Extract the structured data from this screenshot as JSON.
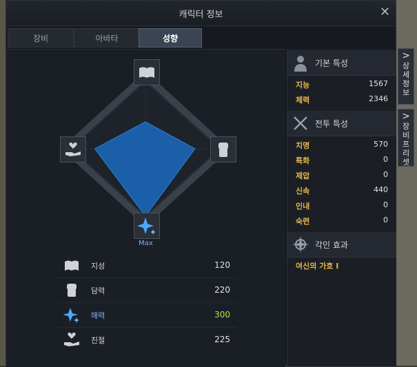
{
  "window": {
    "title": "캐릭터 정보",
    "close": "✕"
  },
  "tabs": [
    {
      "label": "장비",
      "active": false
    },
    {
      "label": "아바타",
      "active": false
    },
    {
      "label": "성향",
      "active": true
    }
  ],
  "trait_chart": {
    "max_label": "Max",
    "axes": [
      "지성",
      "담력",
      "매력",
      "친절"
    ]
  },
  "traits": [
    {
      "name": "지성",
      "value": "120",
      "icon": "book-icon"
    },
    {
      "name": "담력",
      "value": "220",
      "icon": "fist-icon"
    },
    {
      "name": "매력",
      "value": "300",
      "icon": "sparkle-icon",
      "highlight": true
    },
    {
      "name": "친절",
      "value": "225",
      "icon": "heart-hand-icon"
    }
  ],
  "basic_stats": {
    "title": "기본 특성",
    "rows": [
      {
        "label": "지능",
        "value": "1567"
      },
      {
        "label": "체력",
        "value": "2346"
      }
    ]
  },
  "combat_stats": {
    "title": "전투 특성",
    "rows": [
      {
        "label": "치명",
        "value": "570"
      },
      {
        "label": "특화",
        "value": "0"
      },
      {
        "label": "제압",
        "value": "0"
      },
      {
        "label": "신속",
        "value": "440"
      },
      {
        "label": "인내",
        "value": "0"
      },
      {
        "label": "숙련",
        "value": "0"
      }
    ]
  },
  "engraving": {
    "title": "각인 효과",
    "items": [
      "여신의 가호 I"
    ]
  },
  "side_tabs": [
    {
      "chevron": ">",
      "label": "상세정보"
    },
    {
      "chevron": ">",
      "label": "장비프리셋"
    }
  ],
  "colors": {
    "accent_gold": "#e8b54a",
    "highlight_blue": "#7fb2ff",
    "highlight_green": "#b7e34a",
    "chart_fill": "#1a5fa8"
  }
}
